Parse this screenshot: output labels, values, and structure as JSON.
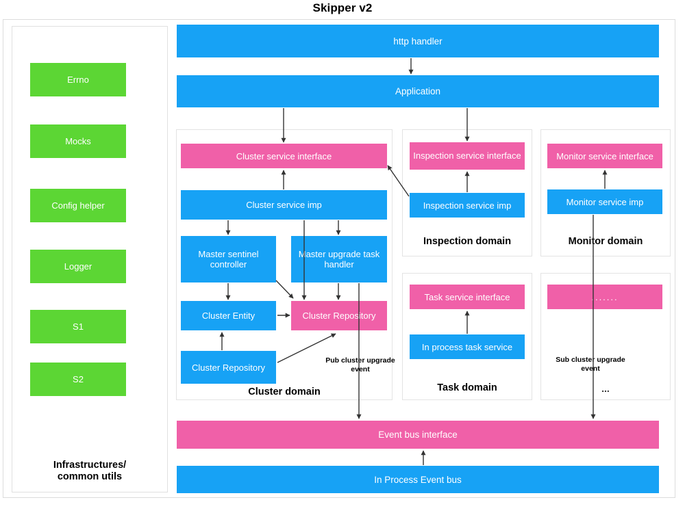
{
  "title": "Skipper v2",
  "colors": {
    "blue": "#17A2F5",
    "pink": "#F060A8",
    "green": "#5CD634",
    "frame": "#e0e0e0",
    "arrow": "#333333"
  },
  "infrastructure": {
    "caption": "Infrastructures/\ncommon utils",
    "caption_line1": "Infrastructures/",
    "caption_line2": "common utils",
    "items": [
      {
        "label": "Errno"
      },
      {
        "label": "Mocks"
      },
      {
        "label": "Config helper"
      },
      {
        "label": "Logger"
      },
      {
        "label": "S1"
      },
      {
        "label": "S2"
      }
    ]
  },
  "top_layers": [
    {
      "label": "http handler",
      "color": "blue"
    },
    {
      "label": "Application",
      "color": "blue"
    }
  ],
  "domains": [
    {
      "id": "cluster",
      "caption": "Cluster domain",
      "boxes": [
        {
          "label": "Cluster service interface",
          "color": "pink"
        },
        {
          "label": "Cluster service imp",
          "color": "blue"
        },
        {
          "label": "Master sentinel controller",
          "color": "blue"
        },
        {
          "label": "Master upgrade task handler",
          "color": "blue"
        },
        {
          "label": "Cluster Entity",
          "color": "blue"
        },
        {
          "label": "Cluster Repository",
          "color": "pink"
        },
        {
          "label": "Cluster Repository",
          "color": "blue"
        }
      ],
      "note": "Pub cluster upgrade event",
      "note_line1": "Pub cluster upgrade",
      "note_line2": "event"
    },
    {
      "id": "inspection",
      "caption": "Inspection domain",
      "boxes": [
        {
          "label": "Inspection service interface",
          "color": "pink"
        },
        {
          "label": "Inspection service imp",
          "color": "blue"
        }
      ]
    },
    {
      "id": "monitor",
      "caption": "Monitor domain",
      "boxes": [
        {
          "label": "Monitor service interface",
          "color": "pink"
        },
        {
          "label": "Monitor service imp",
          "color": "blue"
        }
      ]
    },
    {
      "id": "task",
      "caption": "Task domain",
      "boxes": [
        {
          "label": "Task service interface",
          "color": "pink"
        },
        {
          "label": "In process task service",
          "color": "blue"
        }
      ]
    },
    {
      "id": "other",
      "caption": "...",
      "boxes": [
        {
          "label": ".......",
          "color": "pink"
        }
      ],
      "note": "Sub cluster upgrade event",
      "note_line1": "Sub cluster upgrade",
      "note_line2": "event"
    }
  ],
  "bottom_layers": [
    {
      "label": "Event bus interface",
      "color": "pink"
    },
    {
      "label": "In Process Event bus",
      "color": "blue"
    }
  ]
}
